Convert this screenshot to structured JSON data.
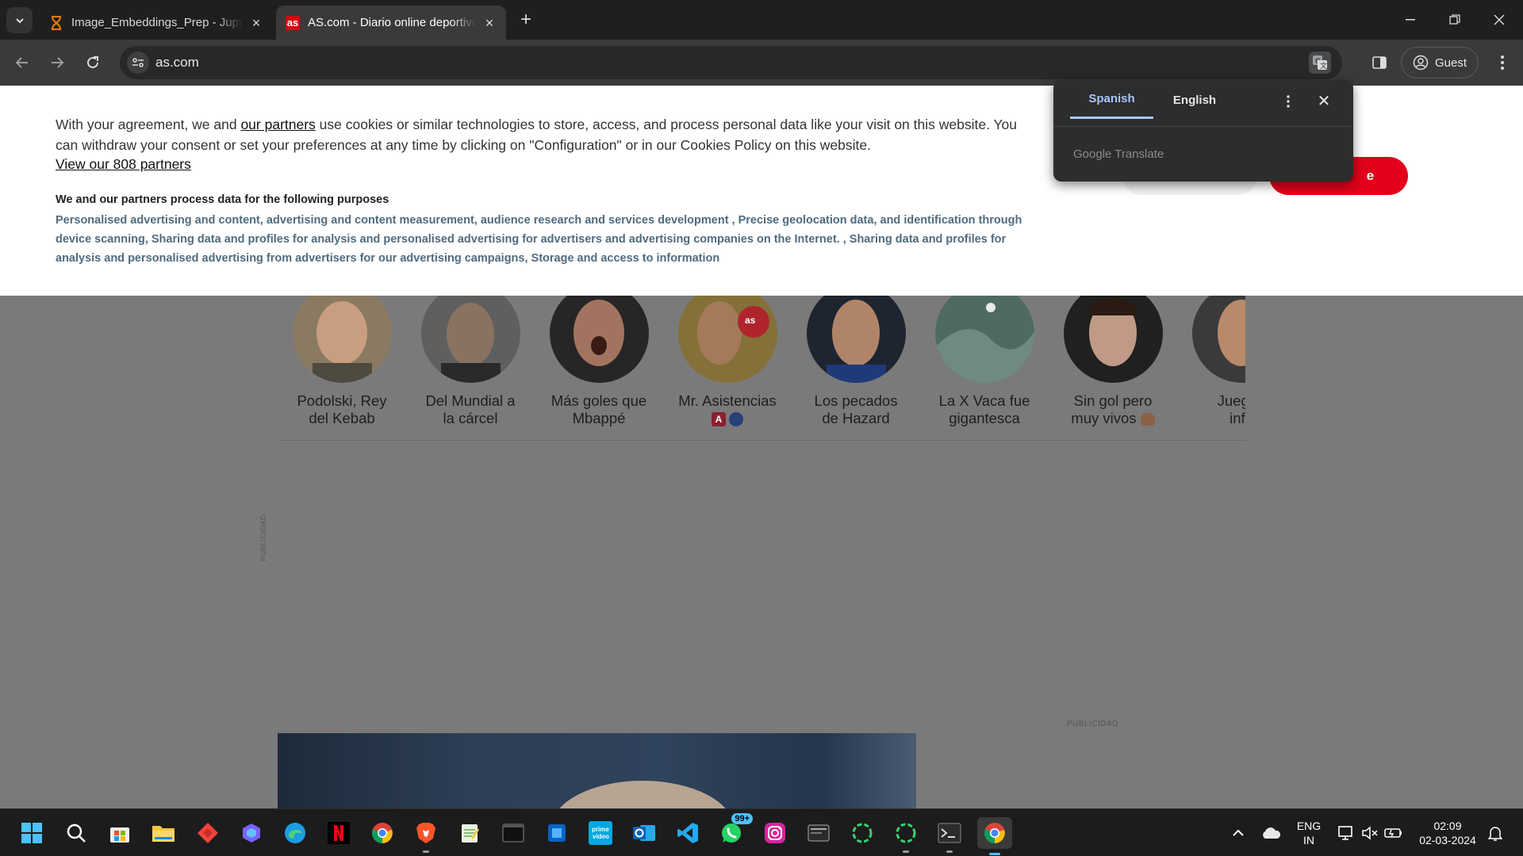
{
  "browser": {
    "tabs": [
      {
        "title": "Image_Embeddings_Prep - Jupyter",
        "active": false
      },
      {
        "title": "AS.com - Diario online deportivo",
        "active": true
      }
    ],
    "url": "as.com",
    "profile_label": "Guest",
    "icons": [
      "tab-search-icon",
      "hourglass-icon",
      "close-icon",
      "plus-icon",
      "minimize-icon",
      "restore-icon",
      "back-icon",
      "forward-icon",
      "reload-icon",
      "site-settings-icon",
      "translate-icon",
      "side-panel-icon",
      "profile-icon",
      "more-vert-icon"
    ]
  },
  "consent": {
    "text_before_link": "With your agreement, we and ",
    "link": "our partners",
    "text_after_link": " use cookies or similar technologies to store, access, and process personal data like your visit on this website. You can withdraw your consent or set your preferences at any time by clicking on \"Configuration\" or in our Cookies Policy on this website.",
    "view_partners": "View our 808 partners",
    "purposes_heading": "We and our partners process data for the following purposes",
    "purposes": "Personalised advertising and content, advertising and content measurement, audience research and services development , Precise geolocation data, and identification through device scanning, Sharing data and profiles for analysis and personalised advertising for advertisers and advertising companies on the Internet. , Sharing data and profiles for analysis and personalised advertising from advertisers for our advertising campaigns, Storage and access to information",
    "accept_label": "e"
  },
  "translate_popup": {
    "tabs": [
      "Spanish",
      "English"
    ],
    "active_tab": "Spanish",
    "brand": "Google Translate"
  },
  "stories": [
    {
      "line1": "Podolski, Rey",
      "line2": "del Kebab"
    },
    {
      "line1": "Del Mundial a",
      "line2": "la cárcel"
    },
    {
      "line1": "Más goles que",
      "line2": "Mbappé"
    },
    {
      "line1": "Mr. Asistencias",
      "line2": "",
      "badge": "A"
    },
    {
      "line1": "Los pecados",
      "line2": "de Hazard"
    },
    {
      "line1": "La X Vaca fue",
      "line2": "gigantesca"
    },
    {
      "line1": "Sin gol pero",
      "line2": "muy vivos"
    },
    {
      "line1": "Juegan",
      "line2": "infa"
    }
  ],
  "ads": {
    "vertical_label": "PUBLICIDAD",
    "right_label": "PUBLICIDAD"
  },
  "taskbar": {
    "apps": [
      "start",
      "search",
      "store",
      "file-explorer",
      "anydesk",
      "copilot",
      "edge",
      "netflix",
      "chrome",
      "brave",
      "notepad",
      "terminal-dark",
      "windows-store-blue",
      "prime-video",
      "outlook",
      "vscode",
      "whatsapp",
      "instagram",
      "app-window",
      "circle-app",
      "circle-app-2",
      "terminal",
      "chrome-active"
    ],
    "prime_label": "prime video",
    "whatsapp_badge": "99+",
    "lang_line1": "ENG",
    "lang_line2": "IN",
    "time": "02:09",
    "date": "02-03-2024"
  },
  "colors": {
    "accent_red": "#e2001a",
    "translate_accent": "#a8c7fa",
    "purposes_text": "#4f6b7f"
  }
}
